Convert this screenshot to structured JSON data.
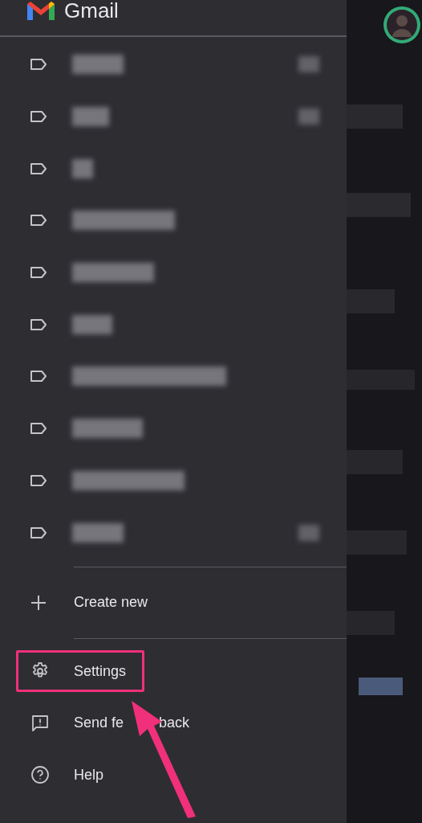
{
  "app_title": "Gmail",
  "labels": [
    {
      "kind": "blurred",
      "has_count": true
    },
    {
      "kind": "blurred",
      "has_count": true
    },
    {
      "kind": "blurred",
      "has_count": false
    },
    {
      "kind": "blurred",
      "has_count": false
    },
    {
      "kind": "blurred",
      "has_count": false
    },
    {
      "kind": "blurred",
      "has_count": false
    },
    {
      "kind": "blurred",
      "has_count": false
    },
    {
      "kind": "blurred",
      "has_count": false
    },
    {
      "kind": "blurred",
      "has_count": false
    },
    {
      "kind": "blurred",
      "has_count": true
    }
  ],
  "create_new": {
    "label": "Create new"
  },
  "menu": [
    {
      "kind": "settings",
      "label": "Settings",
      "highlighted": true
    },
    {
      "kind": "feedback",
      "label": "Send fe",
      "label_after_arrow": "back",
      "highlighted": false
    },
    {
      "kind": "help",
      "label": "Help",
      "highlighted": false
    }
  ]
}
